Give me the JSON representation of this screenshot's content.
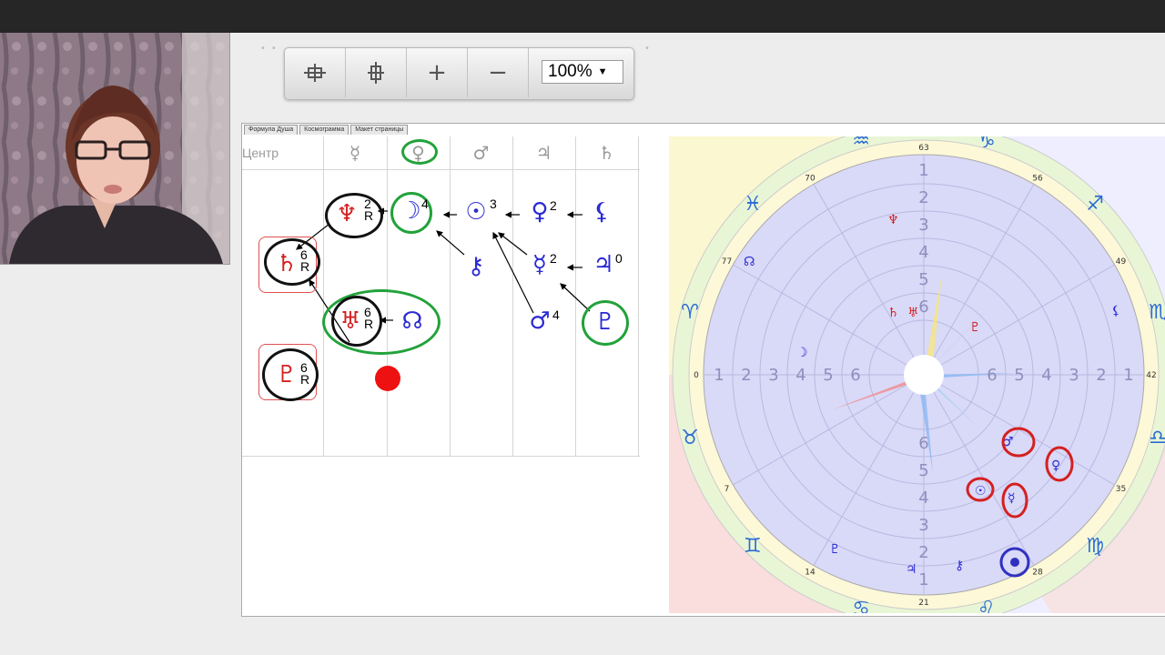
{
  "toolbar": {
    "fit_width_icon": "fit-width-icon",
    "fit_height_icon": "fit-height-icon",
    "zoom_in_label": "+",
    "zoom_out_label": "−",
    "zoom_value": "100%"
  },
  "tabs": [
    "Формула Душа",
    "Космограмма",
    "Макет страницы"
  ],
  "grid": {
    "center_header": "Центр",
    "headers": [
      "☿",
      "♀",
      "♂",
      "♃",
      "♄"
    ],
    "cells": [
      {
        "glyph": "♆",
        "label": "2\nR"
      },
      {
        "glyph": "☽",
        "label": "4"
      },
      {
        "glyph": "☉",
        "label": "3"
      },
      {
        "glyph": "♀",
        "label": "2"
      },
      {
        "glyph": "⚸",
        "label": ""
      },
      {
        "glyph": "♄",
        "label": "6\nR"
      },
      {
        "glyph": "⚷",
        "label": ""
      },
      {
        "glyph": "☿",
        "label": "2"
      },
      {
        "glyph": "♃",
        "label": "0"
      },
      {
        "glyph": "♅",
        "label": "6\nR"
      },
      {
        "glyph": "☊",
        "label": ""
      },
      {
        "glyph": "♂",
        "label": "4"
      },
      {
        "glyph": "♇",
        "label": ""
      },
      {
        "glyph": "♇",
        "label": "6\nR"
      }
    ]
  },
  "wheel": {
    "signs": [
      "♑",
      "♐",
      "♏",
      "♎",
      "♍",
      "♌",
      "♋",
      "♊",
      "♉",
      "♈",
      "♓",
      "♒"
    ],
    "degree_labels": [
      "63",
      "56",
      "49",
      "42",
      "35",
      "28",
      "21",
      "14",
      "7",
      "0",
      "77",
      "70"
    ],
    "ring_numbers": [
      "1",
      "2",
      "3",
      "4",
      "5",
      "6"
    ],
    "colors": {
      "red": "#d42020",
      "blue": "#2b2bd4",
      "green": "#22a23a",
      "black": "#111111"
    }
  }
}
